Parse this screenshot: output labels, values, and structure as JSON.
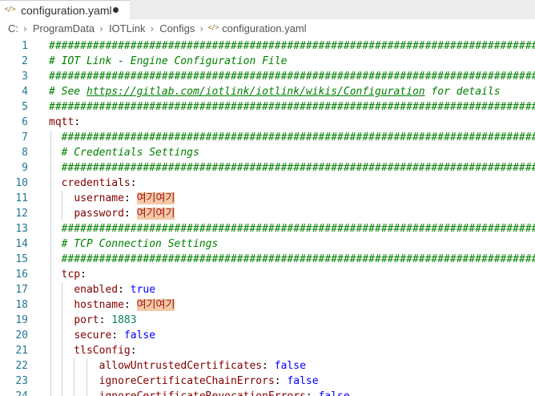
{
  "tab": {
    "title": "configuration.yaml",
    "icon": "yaml-file-icon",
    "dirty": "●"
  },
  "breadcrumb": [
    "C:",
    "ProgramData",
    "IOTLink",
    "Configs",
    "configuration.yaml"
  ],
  "editor": {
    "lines": [
      {
        "n": "1",
        "text": "##############################################################################"
      },
      {
        "n": "2",
        "text": "# IOT Link - Engine Configuration File"
      },
      {
        "n": "3",
        "text": "##############################################################################"
      },
      {
        "n": "4",
        "pre": "# See ",
        "link": "https://gitlab.com/iotlink/iotlink/wikis/Configuration",
        "post": " for details"
      },
      {
        "n": "5",
        "text": "##############################################################################"
      },
      {
        "n": "6",
        "text": "mqtt:"
      },
      {
        "n": "7",
        "text": "  ##############################################################################"
      },
      {
        "n": "8",
        "text": "  # Credentials Settings"
      },
      {
        "n": "9",
        "text": "  ##############################################################################"
      },
      {
        "n": "10",
        "text": "  credentials:"
      },
      {
        "n": "11",
        "key": "username",
        "value": "여기여기",
        "indent": "    "
      },
      {
        "n": "12",
        "key": "password",
        "value": "여기여기",
        "indent": "    "
      },
      {
        "n": "13",
        "text": "  ##############################################################################"
      },
      {
        "n": "14",
        "text": "  # TCP Connection Settings"
      },
      {
        "n": "15",
        "text": "  ##############################################################################"
      },
      {
        "n": "16",
        "text": "  tcp:"
      },
      {
        "n": "17",
        "key": "enabled",
        "value": "true",
        "indent": "    "
      },
      {
        "n": "18",
        "key": "hostname",
        "value": "여기여기",
        "indent": "    "
      },
      {
        "n": "19",
        "key": "port",
        "value": "1883",
        "indent": "    "
      },
      {
        "n": "20",
        "key": "secure",
        "value": "false",
        "indent": "    "
      },
      {
        "n": "21",
        "text": "    tlsConfig:"
      },
      {
        "n": "22",
        "key": "allowUntrustedCertificates",
        "value": "false",
        "indent": "        "
      },
      {
        "n": "23",
        "key": "ignoreCertificateChainErrors",
        "value": "false",
        "indent": "        "
      },
      {
        "n": "24",
        "key": "ignoreCertificateRevocationErrors",
        "value": "false",
        "indent": "        "
      }
    ]
  }
}
